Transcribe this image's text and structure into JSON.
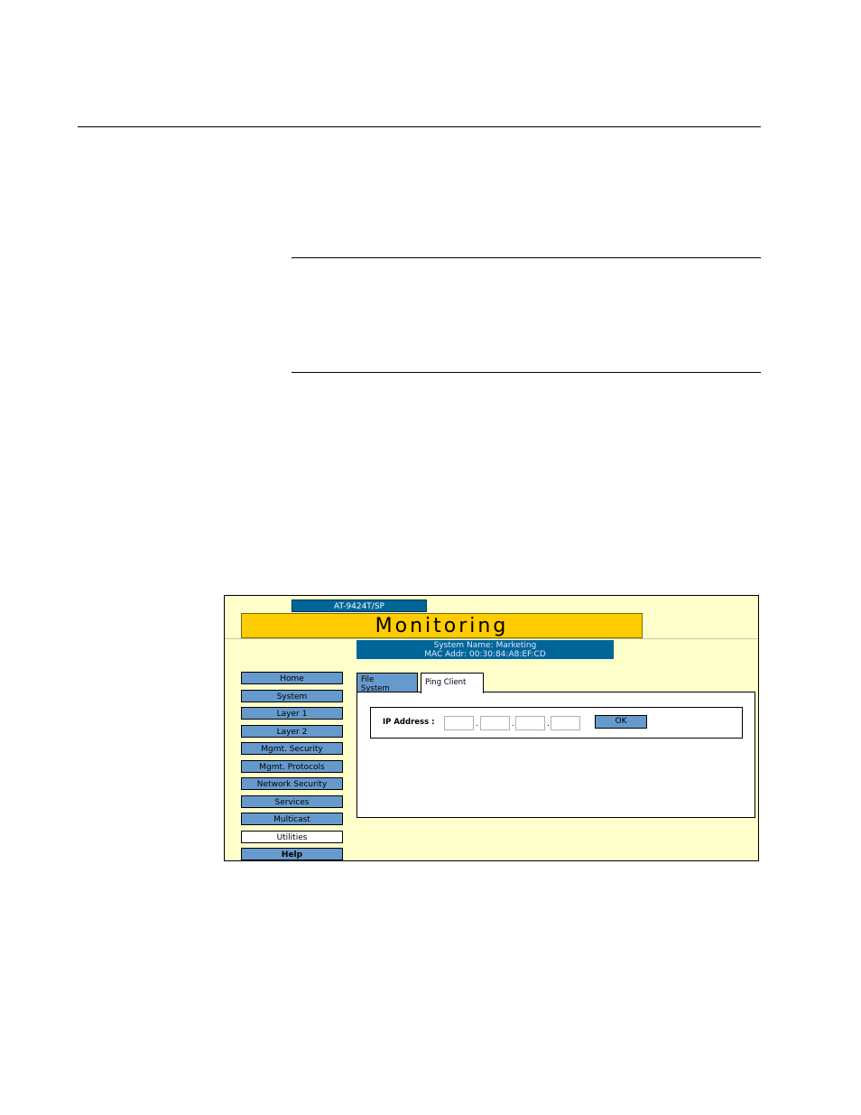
{
  "header": {
    "model": "AT-9424T/SP",
    "title": "Monitoring",
    "system_name": "System Name: Marketing",
    "mac_addr": "MAC Addr: 00:30:84:A8:EF:CD"
  },
  "nav": {
    "items": [
      {
        "label": "Home"
      },
      {
        "label": "System"
      },
      {
        "label": "Layer 1"
      },
      {
        "label": "Layer 2"
      },
      {
        "label": "Mgmt. Security"
      },
      {
        "label": "Mgmt. Protocols"
      },
      {
        "label": "Network Security"
      },
      {
        "label": "Services"
      },
      {
        "label": "Multicast"
      },
      {
        "label": "Utilities"
      },
      {
        "label": "Help"
      }
    ],
    "active": "Utilities"
  },
  "tabs": [
    {
      "label_line1": "File",
      "label_line2": "System"
    },
    {
      "label": "Ping Client"
    }
  ],
  "ping": {
    "ip_label": "IP Address :",
    "octets": [
      "",
      "",
      "",
      ""
    ],
    "separator": ".",
    "ok_label": "OK"
  },
  "colors": {
    "background": "#ffffcc",
    "accent_blue": "#6699cc",
    "title_yellow": "#ffcc00",
    "header_blue": "#006699"
  }
}
